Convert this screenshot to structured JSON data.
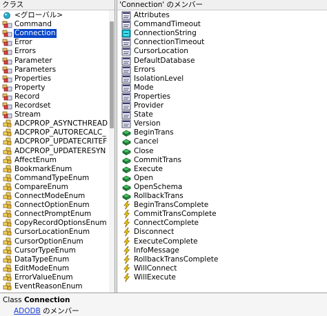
{
  "classes_pane": {
    "header": "クラス",
    "items": [
      {
        "label": "<グローバル>",
        "icon": "globe-icon"
      },
      {
        "label": "Command",
        "icon": "class-icon"
      },
      {
        "label": "Connection",
        "icon": "class-icon",
        "selected": true
      },
      {
        "label": "Error",
        "icon": "class-icon"
      },
      {
        "label": "Errors",
        "icon": "class-icon"
      },
      {
        "label": "Parameter",
        "icon": "class-icon"
      },
      {
        "label": "Parameters",
        "icon": "class-icon"
      },
      {
        "label": "Properties",
        "icon": "class-icon"
      },
      {
        "label": "Property",
        "icon": "class-icon"
      },
      {
        "label": "Record",
        "icon": "class-icon"
      },
      {
        "label": "Recordset",
        "icon": "class-icon"
      },
      {
        "label": "Stream",
        "icon": "class-icon"
      },
      {
        "label": "ADCPROP_ASYNCTHREAD",
        "icon": "enum-icon"
      },
      {
        "label": "ADCPROP_AUTORECALC_",
        "icon": "enum-icon"
      },
      {
        "label": "ADCPROP_UPDATECRITEF",
        "icon": "enum-icon"
      },
      {
        "label": "ADCPROP_UPDATERESYN",
        "icon": "enum-icon"
      },
      {
        "label": "AffectEnum",
        "icon": "enum-icon"
      },
      {
        "label": "BookmarkEnum",
        "icon": "enum-icon"
      },
      {
        "label": "CommandTypeEnum",
        "icon": "enum-icon"
      },
      {
        "label": "CompareEnum",
        "icon": "enum-icon"
      },
      {
        "label": "ConnectModeEnum",
        "icon": "enum-icon"
      },
      {
        "label": "ConnectOptionEnum",
        "icon": "enum-icon"
      },
      {
        "label": "ConnectPromptEnum",
        "icon": "enum-icon"
      },
      {
        "label": "CopyRecordOptionsEnum",
        "icon": "enum-icon"
      },
      {
        "label": "CursorLocationEnum",
        "icon": "enum-icon"
      },
      {
        "label": "CursorOptionEnum",
        "icon": "enum-icon"
      },
      {
        "label": "CursorTypeEnum",
        "icon": "enum-icon"
      },
      {
        "label": "DataTypeEnum",
        "icon": "enum-icon"
      },
      {
        "label": "EditModeEnum",
        "icon": "enum-icon"
      },
      {
        "label": "ErrorValueEnum",
        "icon": "enum-icon"
      },
      {
        "label": "EventReasonEnum",
        "icon": "enum-icon"
      }
    ]
  },
  "members_pane": {
    "header": "'Connection' のメンバー",
    "items": [
      {
        "label": "Attributes",
        "icon": "property-icon"
      },
      {
        "label": "CommandTimeout",
        "icon": "property-icon"
      },
      {
        "label": "ConnectionString",
        "icon": "default-property-icon"
      },
      {
        "label": "ConnectionTimeout",
        "icon": "property-icon"
      },
      {
        "label": "CursorLocation",
        "icon": "property-icon"
      },
      {
        "label": "DefaultDatabase",
        "icon": "property-icon"
      },
      {
        "label": "Errors",
        "icon": "property-icon"
      },
      {
        "label": "IsolationLevel",
        "icon": "property-icon"
      },
      {
        "label": "Mode",
        "icon": "property-icon"
      },
      {
        "label": "Properties",
        "icon": "property-icon"
      },
      {
        "label": "Provider",
        "icon": "property-icon"
      },
      {
        "label": "State",
        "icon": "property-icon"
      },
      {
        "label": "Version",
        "icon": "property-icon"
      },
      {
        "label": "BeginTrans",
        "icon": "method-icon"
      },
      {
        "label": "Cancel",
        "icon": "method-icon"
      },
      {
        "label": "Close",
        "icon": "method-icon"
      },
      {
        "label": "CommitTrans",
        "icon": "method-icon"
      },
      {
        "label": "Execute",
        "icon": "method-icon"
      },
      {
        "label": "Open",
        "icon": "method-icon"
      },
      {
        "label": "OpenSchema",
        "icon": "method-icon"
      },
      {
        "label": "RollbackTrans",
        "icon": "method-icon"
      },
      {
        "label": "BeginTransComplete",
        "icon": "event-icon"
      },
      {
        "label": "CommitTransComplete",
        "icon": "event-icon"
      },
      {
        "label": "ConnectComplete",
        "icon": "event-icon"
      },
      {
        "label": "Disconnect",
        "icon": "event-icon"
      },
      {
        "label": "ExecuteComplete",
        "icon": "event-icon"
      },
      {
        "label": "InfoMessage",
        "icon": "event-icon"
      },
      {
        "label": "RollbackTransComplete",
        "icon": "event-icon"
      },
      {
        "label": "WillConnect",
        "icon": "event-icon"
      },
      {
        "label": "WillExecute",
        "icon": "event-icon"
      }
    ]
  },
  "details": {
    "kind": "Class",
    "name": "Connection",
    "library_link": "ADODB",
    "member_of_suffix": " のメンバー"
  },
  "colors": {
    "selection": "#0a47c9",
    "link": "#1c3fd8"
  }
}
